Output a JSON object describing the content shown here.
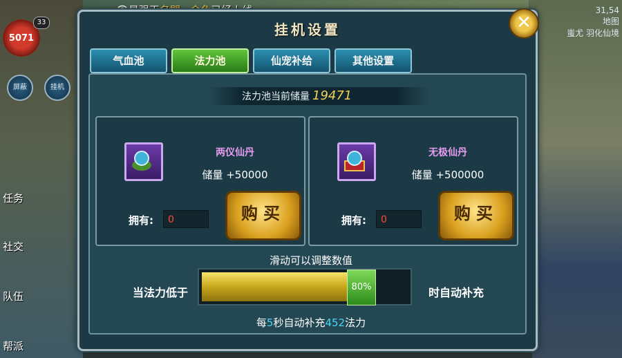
{
  "broadcast": {
    "prefix": "最强王",
    "name1": "名門",
    "middle": ",,,",
    "name2": "金鱼",
    "suffix": "已经上线"
  },
  "hud": {
    "power": "5071",
    "level": "33"
  },
  "side": {
    "btn1": "屏蔽",
    "btn2": "挂机",
    "labels": [
      "任务",
      "社交",
      "队伍",
      "帮派"
    ]
  },
  "topright": {
    "coords": "31,54",
    "map": "地图",
    "npc": "蚩尤  羽化仙境"
  },
  "dialog": {
    "title": "挂机设置",
    "close_label": "✕",
    "tabs": [
      {
        "label": "气血池",
        "active": false
      },
      {
        "label": "法力池",
        "active": true
      },
      {
        "label": "仙宠补给",
        "active": false
      },
      {
        "label": "其他设置",
        "active": false
      }
    ],
    "stock_label": "法力池当前储量",
    "stock_value": "19471",
    "items": [
      {
        "name": "两仪仙丹",
        "stock": "储量 +50000",
        "own_label": "拥有:",
        "own_value": "0",
        "buy_label": "购买"
      },
      {
        "name": "无极仙丹",
        "stock": "储量 +500000",
        "own_label": "拥有:",
        "own_value": "0",
        "buy_label": "购买"
      }
    ],
    "slider_hint": "滑动可以调整数值",
    "low_label": "当法力低于",
    "slider_value": "80%",
    "slider_fraction": 0.8,
    "auto_label": "时自动补充",
    "regen": {
      "prefix": "每",
      "seconds": "5",
      "mid": "秒自动补充",
      "amount": "452",
      "suffix": "法力"
    }
  },
  "colors": {
    "accent_green": "#4fb72f",
    "accent_gold": "#f3d155",
    "highlight_cyan": "#4ad6f0",
    "own_red": "#ff4a3a"
  }
}
